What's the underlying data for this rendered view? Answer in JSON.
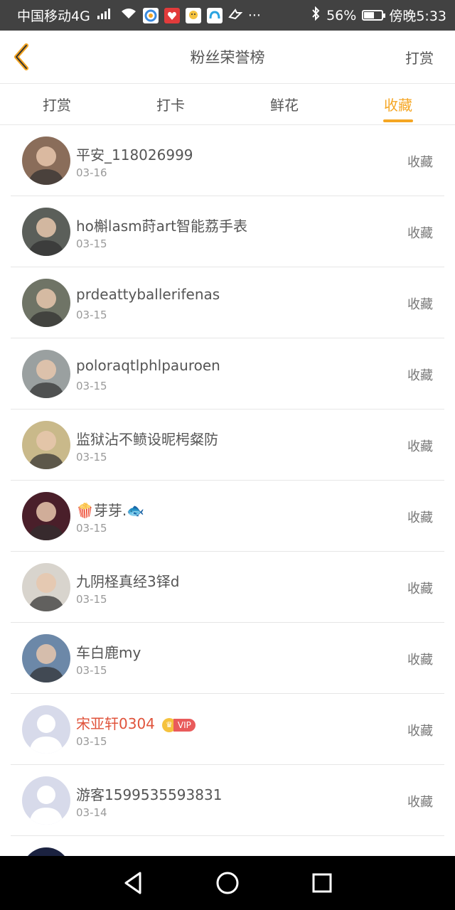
{
  "status_bar": {
    "carrier": "中国移动4G",
    "net_type": "4G",
    "more": "···",
    "battery_percent": "56%",
    "battery_level": 0.56,
    "time": "傍晚5:33",
    "app_icons": [
      "browser-icon",
      "heart-app-icon",
      "chat-app-icon",
      "cloud-app-icon",
      "bird-app-icon"
    ]
  },
  "header": {
    "back_icon": "chevron-left-icon",
    "title": "粉丝荣誉榜",
    "right_action": "打赏"
  },
  "tabs": [
    {
      "label": "打赏",
      "active": false
    },
    {
      "label": "打卡",
      "active": false
    },
    {
      "label": "鲜花",
      "active": false
    },
    {
      "label": "收藏",
      "active": true
    }
  ],
  "list": [
    {
      "name": "平安_118026999",
      "date": "03-16",
      "action": "收藏",
      "avatar_color": "#8a6d5a"
    },
    {
      "name": "ho槲lasm莳art智能荔手表",
      "date": "03-15",
      "action": "收藏",
      "avatar_color": "#5b5f5a"
    },
    {
      "name": "prdeattyballerifenas",
      "date": "03-15",
      "action": "收藏",
      "avatar_color": "#6f7466"
    },
    {
      "name": "poloraqtlphlpauroen",
      "date": "03-15",
      "action": "收藏",
      "avatar_color": "#9aa0a0"
    },
    {
      "name": "监狱沾不鲼设昵枵粲防",
      "date": "03-15",
      "action": "收藏",
      "avatar_color": "#c9b98a"
    },
    {
      "name": "🍿芽芽.🐟",
      "date": "03-15",
      "action": "收藏",
      "avatar_color": "#4a1f2a"
    },
    {
      "name": "九阴柽真经3铎d",
      "date": "03-15",
      "action": "收藏",
      "avatar_color": "#d8d4cd"
    },
    {
      "name": "车白鹿my",
      "date": "03-15",
      "action": "收藏",
      "avatar_color": "#6c88a8"
    },
    {
      "name": "宋亚轩0304",
      "date": "03-15",
      "action": "收藏",
      "avatar_color": "#d7daea",
      "vip": true,
      "vip_label": "VIP"
    },
    {
      "name": "游客1599535593831",
      "date": "03-14",
      "action": "收藏",
      "avatar_color": "#d7daea"
    }
  ],
  "nav": {
    "back_icon": "triangle-back-icon",
    "home_icon": "circle-home-icon",
    "recents_icon": "square-recents-icon"
  },
  "colors": {
    "accent": "#f5a623",
    "vip_name": "#e0533b",
    "status_bar": "#424242"
  }
}
